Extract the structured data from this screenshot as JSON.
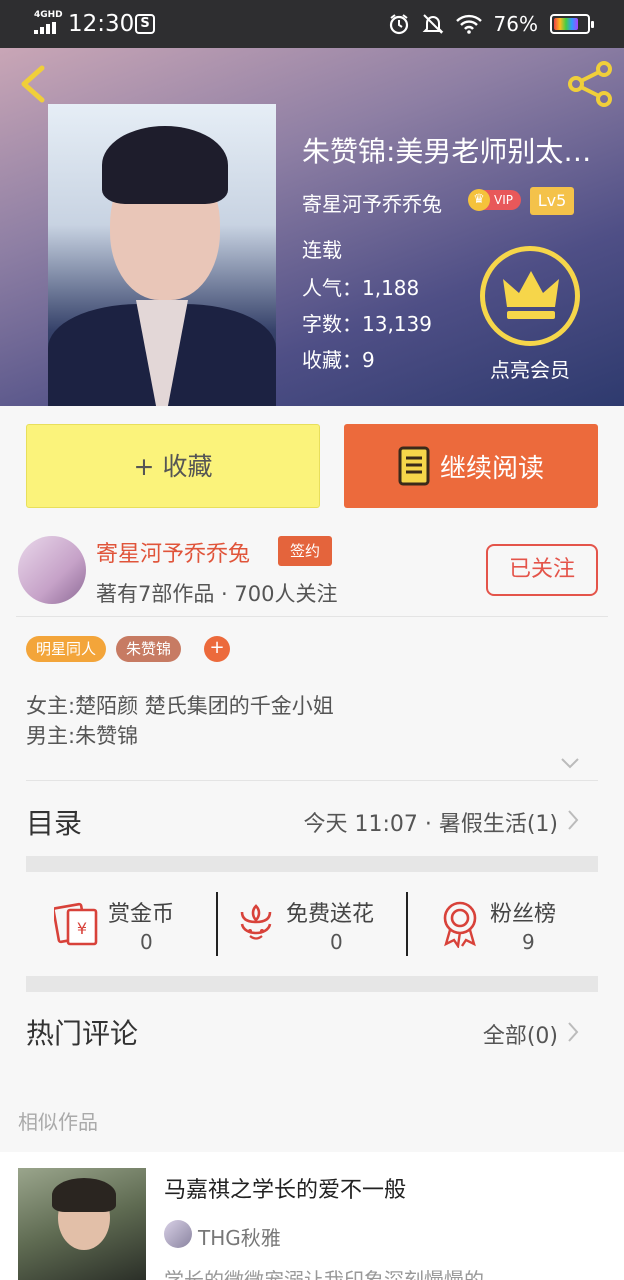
{
  "status_bar": {
    "network": "4GHD",
    "time": "12:30",
    "battery": "76%",
    "battery_level": 0.76
  },
  "book": {
    "title": "朱赞锦:美男老师别太…",
    "author": "寄星河予乔乔兔",
    "vip_label": "VIP",
    "level": "Lv5",
    "status": "连载",
    "popularity": "人气：1,188",
    "word_count": "字数：13,139",
    "favorites": "收藏：9",
    "member_label": "点亮会员"
  },
  "actions": {
    "favorite_label": "+ 收藏",
    "continue_label": "继续阅读"
  },
  "author_card": {
    "name": "寄星河予乔乔兔",
    "badge": "签约",
    "meta": "著有7部作品 · 700人关注",
    "follow_label": "已关注"
  },
  "tags": [
    {
      "label": "明星同人",
      "color": "#f3a53a"
    },
    {
      "label": "朱赞锦",
      "color": "#c77b63"
    }
  ],
  "tag_add": "+",
  "intro": {
    "line1": "女主:楚陌颜  楚氏集团的千金小姐",
    "line2": "男主:朱赞锦"
  },
  "catalog": {
    "title": "目录",
    "latest": "今天 11:07 · 暑假生活(1)"
  },
  "gifts": [
    {
      "label": "赏金币",
      "value": "0",
      "icon": "red-envelope-icon"
    },
    {
      "label": "免费送花",
      "value": "0",
      "icon": "flower-icon"
    },
    {
      "label": "粉丝榜",
      "value": "9",
      "icon": "medal-icon"
    }
  ],
  "comments": {
    "title": "热门评论",
    "all_label": "全部(0)"
  },
  "similar": {
    "section_label": "相似作品",
    "items": [
      {
        "title": "马嘉祺之学长的爱不一般",
        "author": "THG秋雅",
        "desc": "学长的微微宠溺让我印象深刻慢慢的"
      }
    ]
  },
  "colors": {
    "accent": "#ec6a3c",
    "favorite_bg": "#fbf37b",
    "author_name": "#e0543a",
    "follow_border": "#e4544a"
  }
}
